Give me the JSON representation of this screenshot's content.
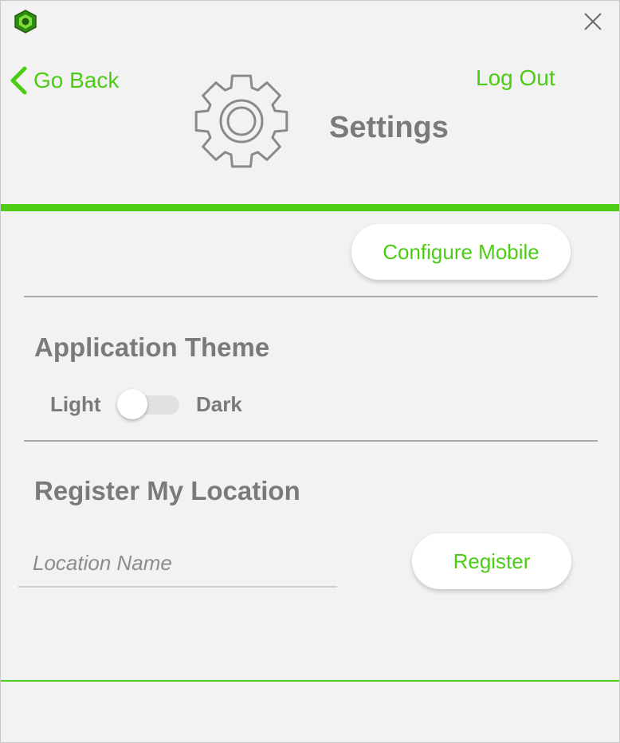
{
  "header": {
    "app_icon": "app-logo-icon",
    "close_icon": "close-icon",
    "back_label": "Go Back",
    "back_icon": "chevron-left-icon",
    "logout_label": "Log Out",
    "page_icon": "gear-icon",
    "title": "Settings"
  },
  "mobile": {
    "configure_label": "Configure Mobile"
  },
  "theme": {
    "section_title": "Application Theme",
    "light_label": "Light",
    "dark_label": "Dark",
    "dark_enabled": false
  },
  "location": {
    "section_title": "Register My Location",
    "input_placeholder": "Location Name",
    "input_value": "",
    "register_label": "Register"
  },
  "colors": {
    "accent": "#4ccc15",
    "title_text": "#7a7a7a",
    "background": "#f2f2f2"
  }
}
